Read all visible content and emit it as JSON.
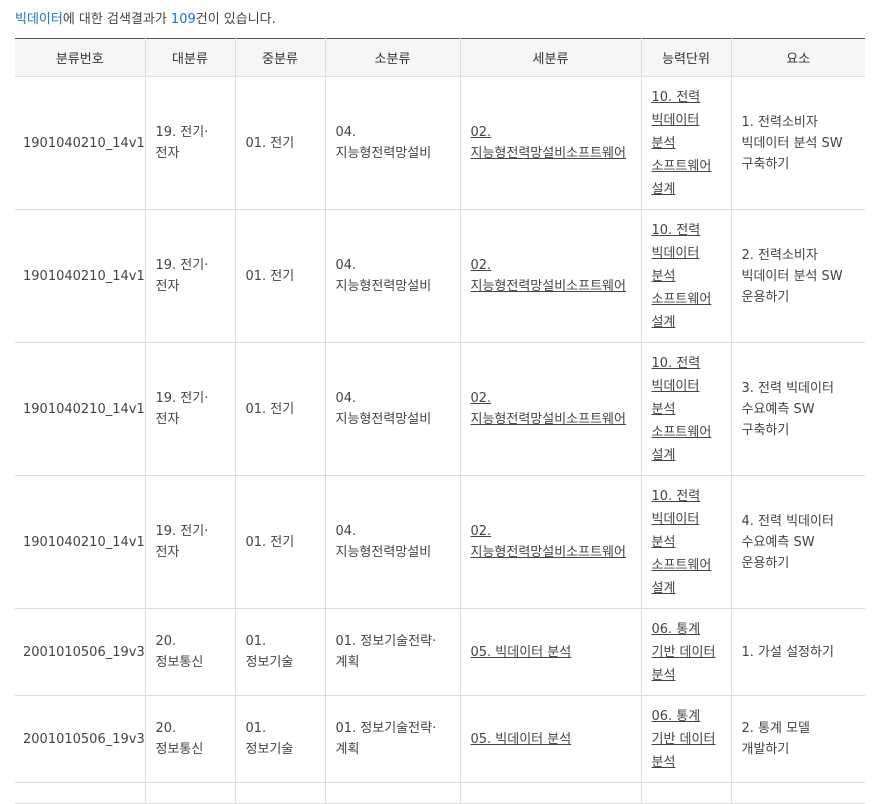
{
  "summary": {
    "keyword": "빅데이터",
    "text1": "에 대한 검색결과가 ",
    "count": "109",
    "text2": "건이 있습니다."
  },
  "columns": [
    "분류번호",
    "대분류",
    "중분류",
    "소분류",
    "세분류",
    "능력단위",
    "요소"
  ],
  "rows": [
    {
      "code": "1901040210_14v1",
      "major": [
        "19. 전기·",
        "전자"
      ],
      "middle": [
        "01. 전기"
      ],
      "minor": [
        "04.",
        "지능형전력망설비"
      ],
      "sub": [
        "02.",
        "지능형전력망설비소프트웨어"
      ],
      "unit": [
        "10. 전력",
        "빅데이터",
        "분석",
        "소프트웨어",
        "설계"
      ],
      "element": [
        "1. 전력소비자",
        "빅데이터 분석 SW",
        "구축하기"
      ]
    },
    {
      "code": "1901040210_14v1",
      "major": [
        "19. 전기·",
        "전자"
      ],
      "middle": [
        "01. 전기"
      ],
      "minor": [
        "04.",
        "지능형전력망설비"
      ],
      "sub": [
        "02.",
        "지능형전력망설비소프트웨어"
      ],
      "unit": [
        "10. 전력",
        "빅데이터",
        "분석",
        "소프트웨어",
        "설계"
      ],
      "element": [
        "2. 전력소비자",
        "빅데이터 분석 SW",
        "운용하기"
      ]
    },
    {
      "code": "1901040210_14v1",
      "major": [
        "19. 전기·",
        "전자"
      ],
      "middle": [
        "01. 전기"
      ],
      "minor": [
        "04.",
        "지능형전력망설비"
      ],
      "sub": [
        "02.",
        "지능형전력망설비소프트웨어"
      ],
      "unit": [
        "10. 전력",
        "빅데이터",
        "분석",
        "소프트웨어",
        "설계"
      ],
      "element": [
        "3. 전력 빅데이터",
        "수요예측 SW",
        "구축하기"
      ]
    },
    {
      "code": "1901040210_14v1",
      "major": [
        "19. 전기·",
        "전자"
      ],
      "middle": [
        "01. 전기"
      ],
      "minor": [
        "04.",
        "지능형전력망설비"
      ],
      "sub": [
        "02.",
        "지능형전력망설비소프트웨어"
      ],
      "unit": [
        "10. 전력",
        "빅데이터",
        "분석",
        "소프트웨어",
        "설계"
      ],
      "element": [
        "4. 전력 빅데이터",
        "수요예측 SW",
        "운용하기"
      ]
    },
    {
      "code": "2001010506_19v3",
      "major": [
        "20.",
        "정보통신"
      ],
      "middle": [
        "01.",
        "정보기술"
      ],
      "minor": [
        "01. 정보기술전략·",
        "계획"
      ],
      "sub": [
        "05. 빅데이터 분석"
      ],
      "unit": [
        "06. 통계",
        "기반 데이터",
        "분석"
      ],
      "element": [
        "1. 가설 설정하기"
      ]
    },
    {
      "code": "2001010506_19v3",
      "major": [
        "20.",
        "정보통신"
      ],
      "middle": [
        "01.",
        "정보기술"
      ],
      "minor": [
        "01. 정보기술전략·",
        "계획"
      ],
      "sub": [
        "05. 빅데이터 분석"
      ],
      "unit": [
        "06. 통계",
        "기반 데이터",
        "분석"
      ],
      "element": [
        "2. 통계 모델",
        "개발하기"
      ]
    }
  ]
}
